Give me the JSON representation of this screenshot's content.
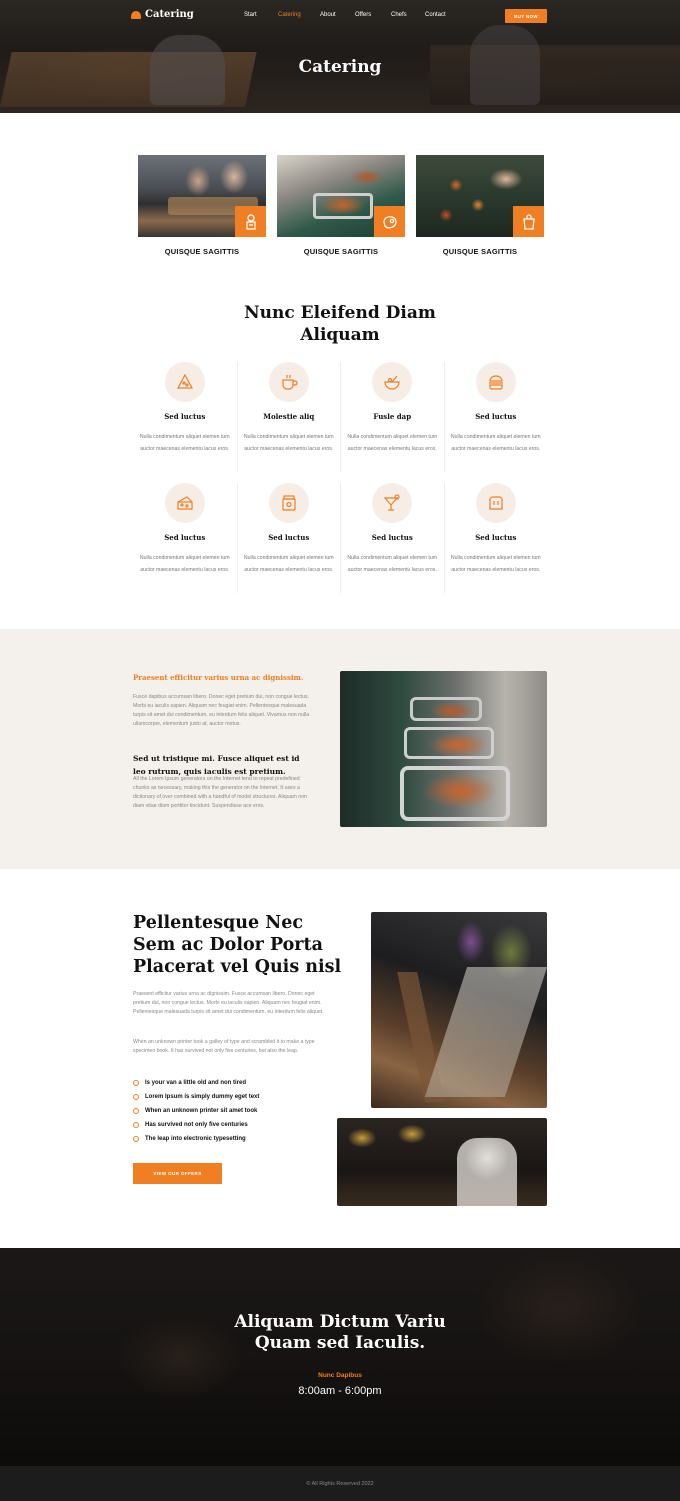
{
  "nav": {
    "brand": "Catering",
    "items": [
      "Start",
      "Catering",
      "About",
      "Offers",
      "Chefs",
      "Contact"
    ],
    "active": "Catering",
    "cta": "BUY NOW"
  },
  "hero": {
    "title": "Catering"
  },
  "services": [
    {
      "caption": "QUISQUE SAGITTIS",
      "icon": "chef-icon"
    },
    {
      "caption": "QUISQUE SAGITTIS",
      "icon": "steak-icon"
    },
    {
      "caption": "QUISQUE SAGITTIS",
      "icon": "shopping-bag-icon"
    }
  ],
  "features": {
    "title_line1": "Nunc Eleifend Diam",
    "title_line2": "Aliquam",
    "items": [
      {
        "title": "Sed luctus",
        "icon": "pizza-slice-icon",
        "desc": "Nulla condimentum aliquet elemen tum auctor maecenas elementu lacus eros."
      },
      {
        "title": "Molestie aliq",
        "icon": "coffee-cup-icon",
        "desc": "Nulla condimentum aliquet elemen tum auctor maecenas elementu lacus eros."
      },
      {
        "title": "Fusle dap",
        "icon": "bowl-icon",
        "desc": "Nulla condimentum aliquet elemen tum auctor maecenas elementu lacus eros."
      },
      {
        "title": "Sed luctus",
        "icon": "burger-icon",
        "desc": "Nulla condimentum aliquet elemen tum auctor maecenas elementu lacus eros."
      },
      {
        "title": "Sed luctus",
        "icon": "cheese-icon",
        "desc": "Nulla condimentum aliquet elemen tum auctor maecenas elementu lacus eros."
      },
      {
        "title": "Sed luctus",
        "icon": "jar-icon",
        "desc": "Nulla condimentum aliquet elemen tum auctor maecenas elementu lacus eros."
      },
      {
        "title": "Sed luctus",
        "icon": "cocktail-icon",
        "desc": "Nulla condimentum aliquet elemen tum auctor maecenas elementu lacus eros."
      },
      {
        "title": "Sed luctus",
        "icon": "bread-icon",
        "desc": "Nulla condimentum aliquet elemen tum auctor maecenas elementu lacus eros."
      }
    ]
  },
  "about": {
    "kicker": "Praesent efficitur varius urna ac dignissim.",
    "para1": "Fusce dapibus accumsan libero. Donec eget pretium dui, non congue lectus. Morbi eu iaculis sapien. Aliquam nec feugiat enim. Pellentesque malesuada turpis sit amet dui condimentum, eu interdum felis aliquet. Vivamus non nulla ullamcorper, elementum justo at, auctor metus.",
    "heading": "Sed ut tristique mi. Fusce aliquet est id leo rutrum, quis iaculis est pretium.",
    "para2": "All the Lorem Ipsum generators on the Internet tend to repeat predefined chunks as necessary, making this the generator on the Internet. It uses a dictionary of over combined with a handful of model structures. Aliquam non diam vitae diam porttitor tincidunt. Suspendisse ace eros."
  },
  "offers": {
    "title": "Pellentesque Nec Sem ac Dolor Porta Placerat vel Quis nisl",
    "para1": "Praesent efficitur varius urna ac dignissim. Fusce accumsan libero. Donec eget pretium dui, non congue lectus. Morbi eu iaculis sapien. Aliquam nec feugiat enim. Pellentesque malesuada turpis sit amet dui condimentum, eu interdum felis aliquet.",
    "para2": "When an unknown printer took a galley of type and scrambled it to make a type specimen book. It has survived not only five centuries, but also the leap.",
    "list": [
      "Is your van a little old and non tired",
      "Lorem Ipsum is simply dummy eget text",
      "When an unknown printer sit amet took",
      "Has survived not only five centuries",
      "The leap into electronic typesetting"
    ],
    "button": "VIEW OUR OFFERS"
  },
  "banner": {
    "title_line1": "Aliquam Dictum Variu",
    "title_line2": "Quam sed Iaculis.",
    "kicker": "Nunc Dapibus",
    "hours": "8:00am - 6:00pm"
  },
  "footer": {
    "copyright": "© All Rights Reserved 2022"
  },
  "colors": {
    "accent": "#f07f23",
    "beige": "#f4f0ec",
    "dark": "#1c1c1c"
  }
}
